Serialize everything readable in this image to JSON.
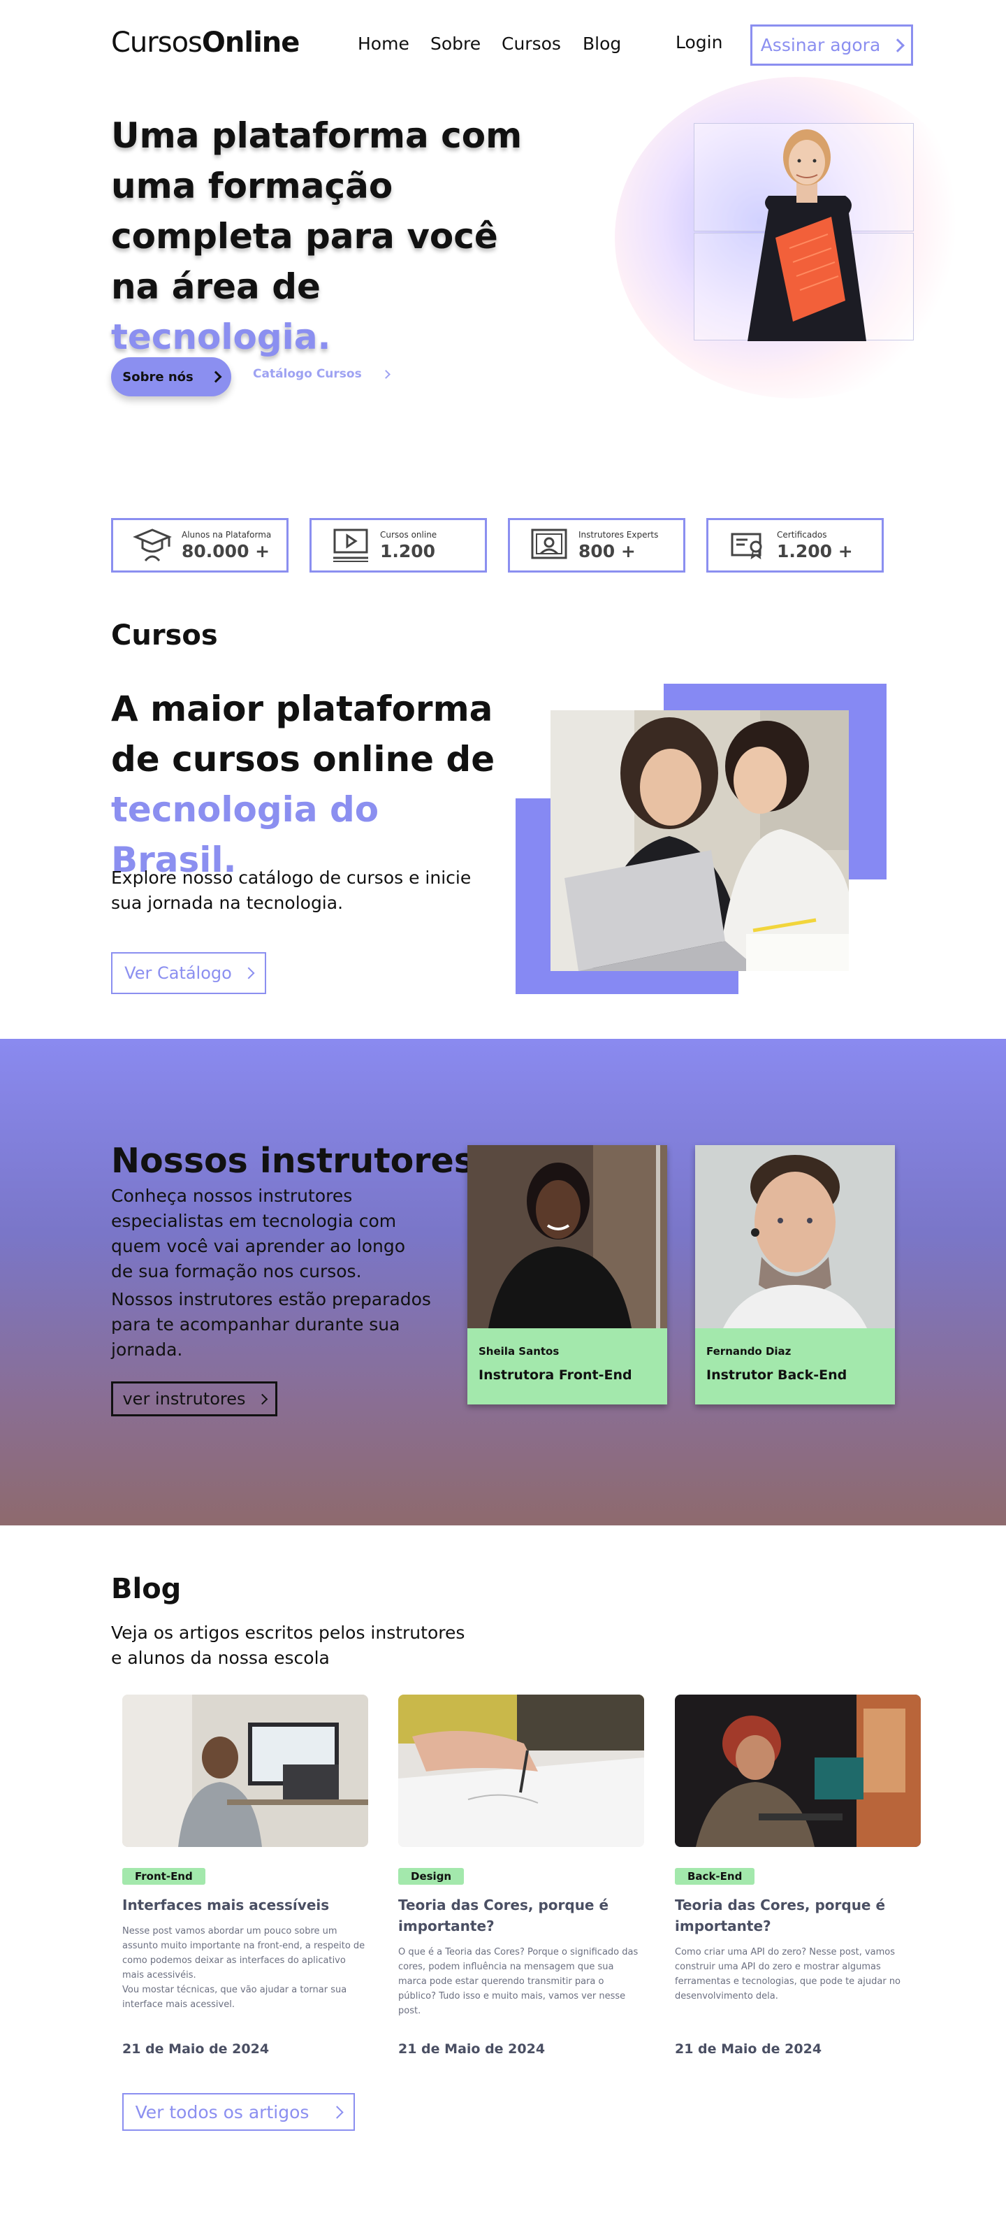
{
  "header": {
    "logo_light": "Cursos",
    "logo_bold": "Online",
    "nav": [
      "Home",
      "Sobre",
      "Cursos",
      "Blog"
    ],
    "login": "Login",
    "cta": "Assinar agora"
  },
  "hero": {
    "title_line1": "Uma plataforma com",
    "title_line2": "uma formação",
    "title_line3": "completa para você",
    "title_line4_prefix": "na área de ",
    "title_accent": "tecnologia.",
    "primary_button": "Sobre nós",
    "secondary_link": "Catálogo Cursos"
  },
  "stats": [
    {
      "label": "Alunos na Plataforma",
      "value": "80.000 +",
      "icon": "graduation-cap-icon"
    },
    {
      "label": "Cursos online",
      "value": "1.200",
      "icon": "play-video-icon"
    },
    {
      "label": "Instrutores Experts",
      "value": "800 +",
      "icon": "instructor-board-icon"
    },
    {
      "label": "Certificados",
      "value": "1.200 +",
      "icon": "certificate-icon"
    }
  ],
  "cursos": {
    "heading": "Cursos",
    "title_line1": "A maior plataforma",
    "title_line2": "de cursos online de",
    "title_accent": "tecnologia do Brasil.",
    "text": "Explore nosso catálogo de cursos e inicie sua jornada na tecnologia.",
    "button": "Ver Catálogo"
  },
  "instrutores": {
    "title": "Nossos instrutores",
    "text1": "Conheça nossos instrutores especialistas em tecnologia com quem você vai aprender ao longo de sua formação nos cursos.",
    "text2": "Nossos instrutores estão preparados para te acompanhar durante sua jornada.",
    "button": "ver instrutores",
    "cards": [
      {
        "name": "Sheila Santos",
        "role": "Instrutora Front-End"
      },
      {
        "name": "Fernando Diaz",
        "role": "Instrutor Back-End"
      }
    ]
  },
  "blog": {
    "heading": "Blog",
    "subtitle": "Veja os artigos escritos pelos instrutores e alunos da nossa escola",
    "posts": [
      {
        "tag": "Front-End",
        "title": "Interfaces mais acessíveis",
        "body": "Nesse post vamos abordar um pouco sobre um assunto muito importante na front-end, a respeito  de como podemos deixar as interfaces do aplicativo mais acessivéis.\nVou mostar técnicas, que vão ajudar a tornar sua interface mais acessivel.",
        "date": "21 de Maio de 2024"
      },
      {
        "tag": "Design",
        "title": "Teoria das Cores, porque é importante?",
        "body": "O que é a Teoria das Cores? Porque o significado das cores, podem influência na mensagem que sua marca pode estar querendo transmitir para o público? Tudo isso e muito mais, vamos ver nesse post.",
        "date": "21 de Maio de 2024"
      },
      {
        "tag": "Back-End",
        "title": "Teoria das Cores, porque é importante?",
        "body": "Como criar uma API do zero? Nesse post, vamos construir uma API do zero e mostrar algumas ferramentas e tecnologias, que pode te ajudar no desenvolvimento dela.",
        "date": "21 de Maio de 2024"
      }
    ],
    "button": "Ver todos os artigos"
  },
  "colors": {
    "accent": "#8b8ff0",
    "tag_green": "#a3e8ac",
    "text_dark": "#111111"
  }
}
